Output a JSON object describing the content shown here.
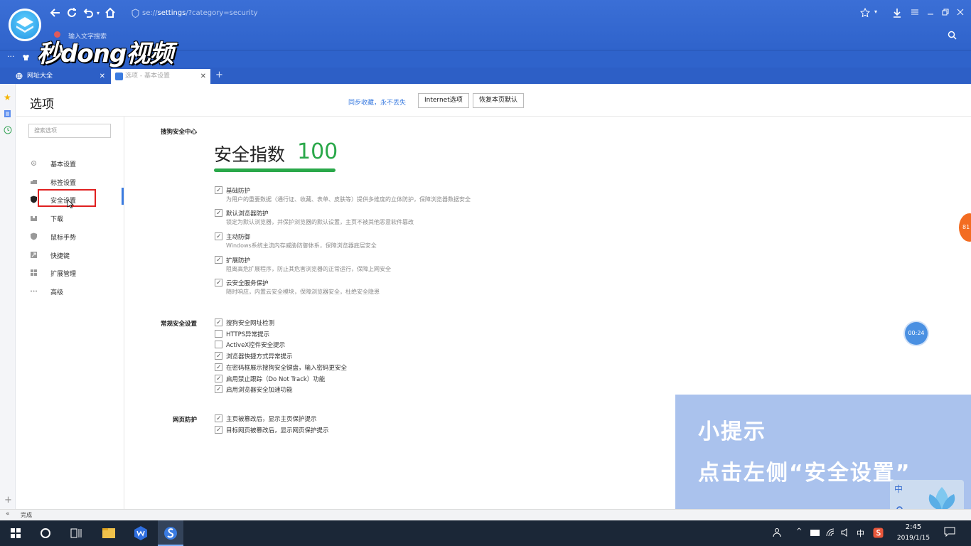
{
  "browser": {
    "address": "se://settings/?category=security",
    "address_scheme": "se://",
    "address_main": "settings",
    "address_query": "/?category=security",
    "search_placeholder": "输入文字搜索",
    "brand_overlay": "秒dong视频",
    "tabs": [
      {
        "label": "网址大全",
        "active": false
      },
      {
        "label": "选项 - 基本设置",
        "active": true
      }
    ],
    "tab_add": "+"
  },
  "options": {
    "title": "选项",
    "sync_text": "同步收藏，永不丢失",
    "internet_button": "Internet选项",
    "restore_button": "恢复本页默认",
    "search_placeholder": "搜索选项"
  },
  "sidebar": {
    "items": [
      {
        "label": "基本设置",
        "icon": "gear-icon"
      },
      {
        "label": "标签设置",
        "icon": "tab-icon"
      },
      {
        "label": "安全设置",
        "icon": "shield-icon",
        "active": true
      },
      {
        "label": "下载",
        "icon": "download-icon"
      },
      {
        "label": "鼠标手势",
        "icon": "mouse-icon"
      },
      {
        "label": "快捷键",
        "icon": "shortcut-icon"
      },
      {
        "label": "扩展管理",
        "icon": "grid-icon"
      },
      {
        "label": "高级",
        "icon": "more-icon"
      }
    ]
  },
  "security": {
    "section_center": "搜狗安全中心",
    "score_label": "安全指数",
    "score_value": "100",
    "score_value_num": 100,
    "protections": [
      {
        "title": "基础防护",
        "desc": "为用户的重要数据（通行证、收藏、表单、皮肤等）提供多维度的立体防护，保障浏览器数据安全",
        "checked": true
      },
      {
        "title": "默认浏览器防护",
        "desc": "锁定为默认浏览器，并保护浏览器的默认设置，主页不被其他恶意软件篡改",
        "checked": true
      },
      {
        "title": "主动防御",
        "desc": "Windows系统主流内存威胁防御体系，保障浏览器底层安全",
        "checked": true
      },
      {
        "title": "扩展防护",
        "desc": "阻离高危扩展程序，防止其危害浏览器的正常运行，保障上网安全",
        "checked": true
      },
      {
        "title": "云安全服务保护",
        "desc": "随时响应，内置云安全模块，保障浏览器安全，杜绝安全隐患",
        "checked": true
      }
    ],
    "section_general": "常规安全设置",
    "general": [
      {
        "label": "搜狗安全网址检测",
        "checked": true
      },
      {
        "label": "HTTPS异常提示",
        "checked": false
      },
      {
        "label": "ActiveX控件安全提示",
        "checked": false
      },
      {
        "label": "浏览器快捷方式异常提示",
        "checked": true
      },
      {
        "label": "在密码框展示搜狗安全键盘，输入密码更安全",
        "checked": true
      },
      {
        "label": "启用禁止跟踪（Do Not Track）功能",
        "checked": true
      },
      {
        "label": "启用浏览器安全加速功能",
        "checked": true
      }
    ],
    "section_web": "网页防护",
    "web": [
      {
        "label": "主页被篡改后，显示主页保护提示",
        "checked": true
      },
      {
        "label": "目标网页被篡改后，显示网页保护提示",
        "checked": true
      }
    ]
  },
  "overlay": {
    "hint_title": "小提示",
    "hint_text": "点击左侧“安全设置”",
    "timer": "00:24",
    "side_bubble": "81",
    "ime_label": "中"
  },
  "status": {
    "text": "完成"
  },
  "taskbar": {
    "time": "2:45",
    "date": "2019/1/15",
    "ime": "中"
  },
  "colors": {
    "accent": "#2f63cb",
    "score_green": "#2aa84a",
    "highlight_red": "#e02020",
    "link_blue": "#3a7be0"
  }
}
